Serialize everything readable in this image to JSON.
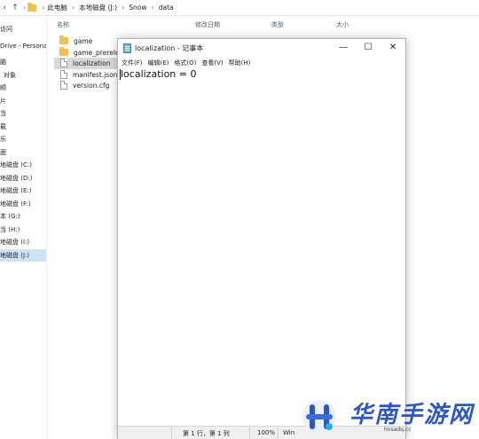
{
  "explorer": {
    "nav_buttons": {
      "up_arrow": "↑",
      "chevron": "›"
    },
    "breadcrumb": [
      "此电脑",
      "本地磁盘 (J:)",
      "Snow",
      "data"
    ],
    "nav_pane": {
      "items": [
        "访问",
        "Drive - Persona",
        "脑",
        "对象",
        "顺",
        "片",
        "当",
        "载",
        "乐",
        "面",
        "地磁盘 (C:)",
        "地磁盘 (D:)",
        "地磁盘 (E:)",
        "地磁盘 (F:)",
        "本 (G:)",
        "当 (H:)",
        "地磁盘 (I:)",
        "地磁盘 (J:)"
      ]
    },
    "columns": {
      "name": "名称",
      "modified": "修改日期",
      "type": "类型",
      "size": "大小"
    },
    "files": [
      {
        "name": "game",
        "kind": "folder"
      },
      {
        "name": "game_prerelease",
        "kind": "folder"
      },
      {
        "name": "localization",
        "kind": "file"
      },
      {
        "name": "manifest.json",
        "kind": "file"
      },
      {
        "name": "version.cfg",
        "kind": "file"
      }
    ]
  },
  "notepad": {
    "title": "localization - 记事本",
    "window_buttons": {
      "minimize": "—",
      "maximize": "☐",
      "close": "✕"
    },
    "menu": [
      "文件(F)",
      "编辑(E)",
      "格式(O)",
      "查看(V)",
      "帮助(H)"
    ],
    "content": "localization = 0",
    "status": {
      "position": "第 1 行，第 1 列",
      "zoom": "100%",
      "line_ending": "Win"
    }
  },
  "watermark": {
    "brand": "华南手游网",
    "url": "hnsadq.cc"
  },
  "colors": {
    "selection": "#cce4f7",
    "folder": "#f0c24a",
    "brand": "#2d56c8",
    "header_text": "#4d6082"
  }
}
